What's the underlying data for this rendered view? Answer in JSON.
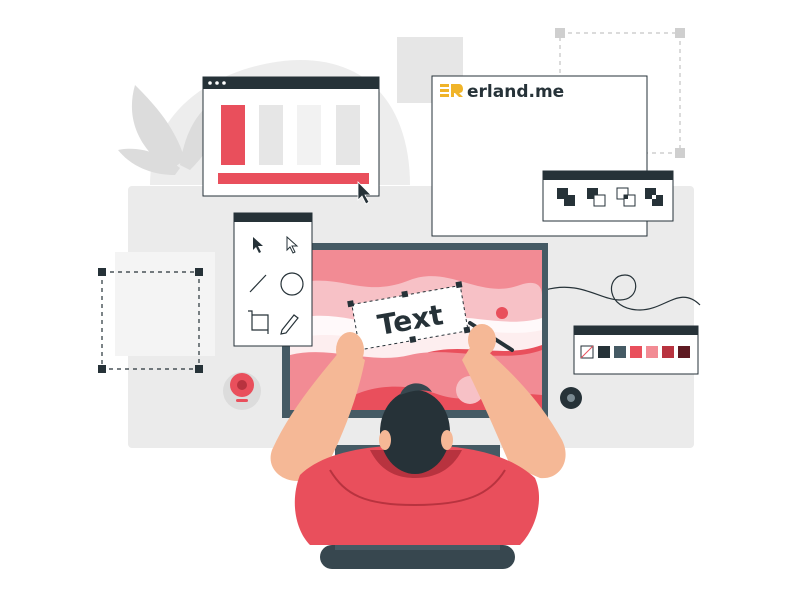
{
  "brand": {
    "name": "erland.me",
    "logo_letters": "ER",
    "logo_color": "#f0b429",
    "text_color": "#263238"
  },
  "canvas_text": "Text",
  "colors": {
    "accent": "#e94f5c",
    "accent_light": "#f28b94",
    "accent_pale": "#f7c1c6",
    "dark": "#263238",
    "gray": "#e6e6e6",
    "gray_mid": "#d6d6d6"
  },
  "palette": {
    "swatches": [
      "#263238",
      "#455a64",
      "#e94f5c",
      "#f28b94",
      "#b8333f",
      "#5e1a22"
    ]
  },
  "tools": {
    "icons": [
      "arrow-cursor-icon",
      "hollow-cursor-icon",
      "line-tool-icon",
      "circle-tool-icon",
      "crop-tool-icon",
      "pen-tool-icon"
    ]
  },
  "bar_chart": {
    "values": [
      1,
      1,
      1,
      1
    ],
    "highlight_index": 0
  }
}
